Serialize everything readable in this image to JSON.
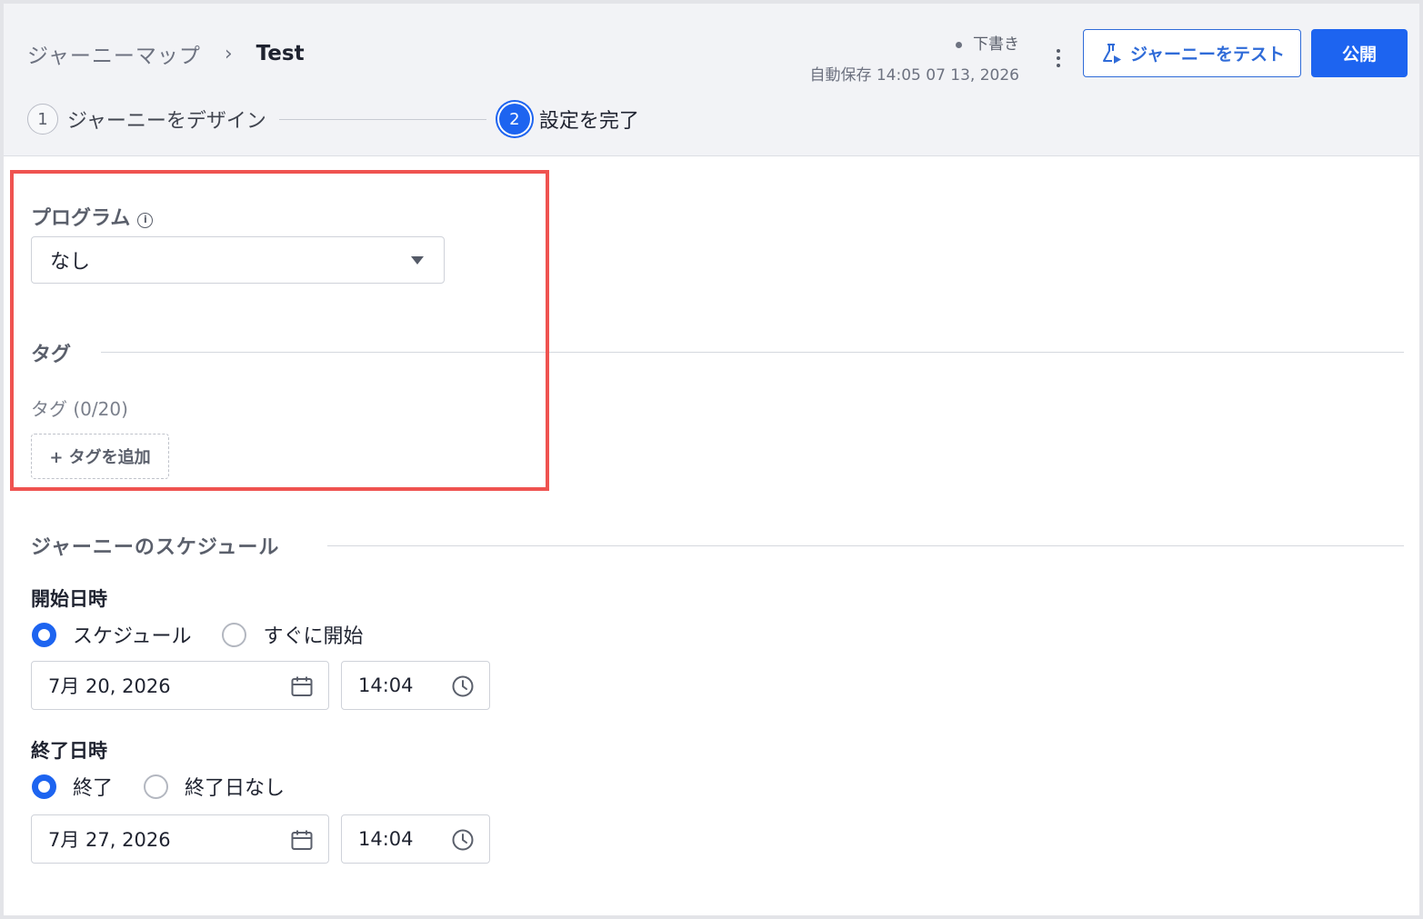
{
  "header": {
    "breadcrumb_root": "ジャーニーマップ",
    "breadcrumb_sep": "›",
    "breadcrumb_current": "Test",
    "status_draft": "下書き",
    "autosave": "自動保存 14:05 07 13, 2026",
    "test_button": "ジャーニーをテスト",
    "publish_button": "公開"
  },
  "steps": [
    {
      "num": "1",
      "label": "ジャーニーをデザイン"
    },
    {
      "num": "2",
      "label": "設定を完了"
    }
  ],
  "program": {
    "label": "プログラム",
    "info": "i",
    "selected": "なし"
  },
  "tags": {
    "label": "タグ",
    "count": "タグ (0/20)",
    "add_button": "+ タグを追加"
  },
  "schedule": {
    "label": "ジャーニーのスケジュール",
    "start": {
      "title": "開始日時",
      "option_schedule": "スケジュール",
      "option_now": "すぐに開始",
      "date": "7月 20, 2026",
      "time": "14:04"
    },
    "end": {
      "title": "終了日時",
      "option_end": "終了",
      "option_none": "終了日なし",
      "date": "7月 27, 2026",
      "time": "14:04"
    }
  },
  "colors": {
    "accent": "#1d64f0",
    "highlight": "#ef5350"
  }
}
